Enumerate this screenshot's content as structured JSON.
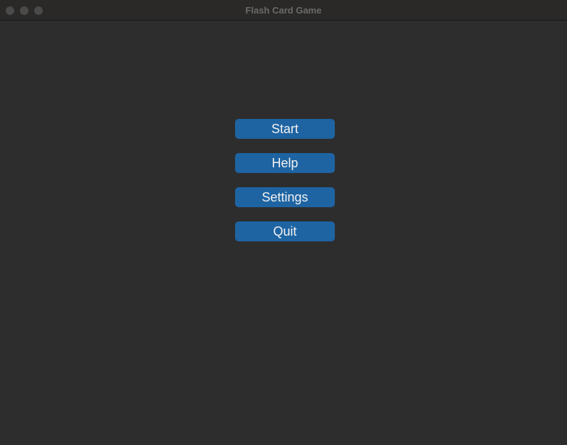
{
  "window": {
    "title": "Flash Card Game"
  },
  "menu": {
    "buttons": [
      {
        "label": "Start"
      },
      {
        "label": "Help"
      },
      {
        "label": "Settings"
      },
      {
        "label": "Quit"
      }
    ]
  },
  "colors": {
    "background": "#2d2d2d",
    "titlebar": "#2a2928",
    "button": "#1e64a3",
    "button_text": "#f2f2f2",
    "title_text": "#6a6a6a",
    "traffic_light": "#4a4a4a"
  }
}
